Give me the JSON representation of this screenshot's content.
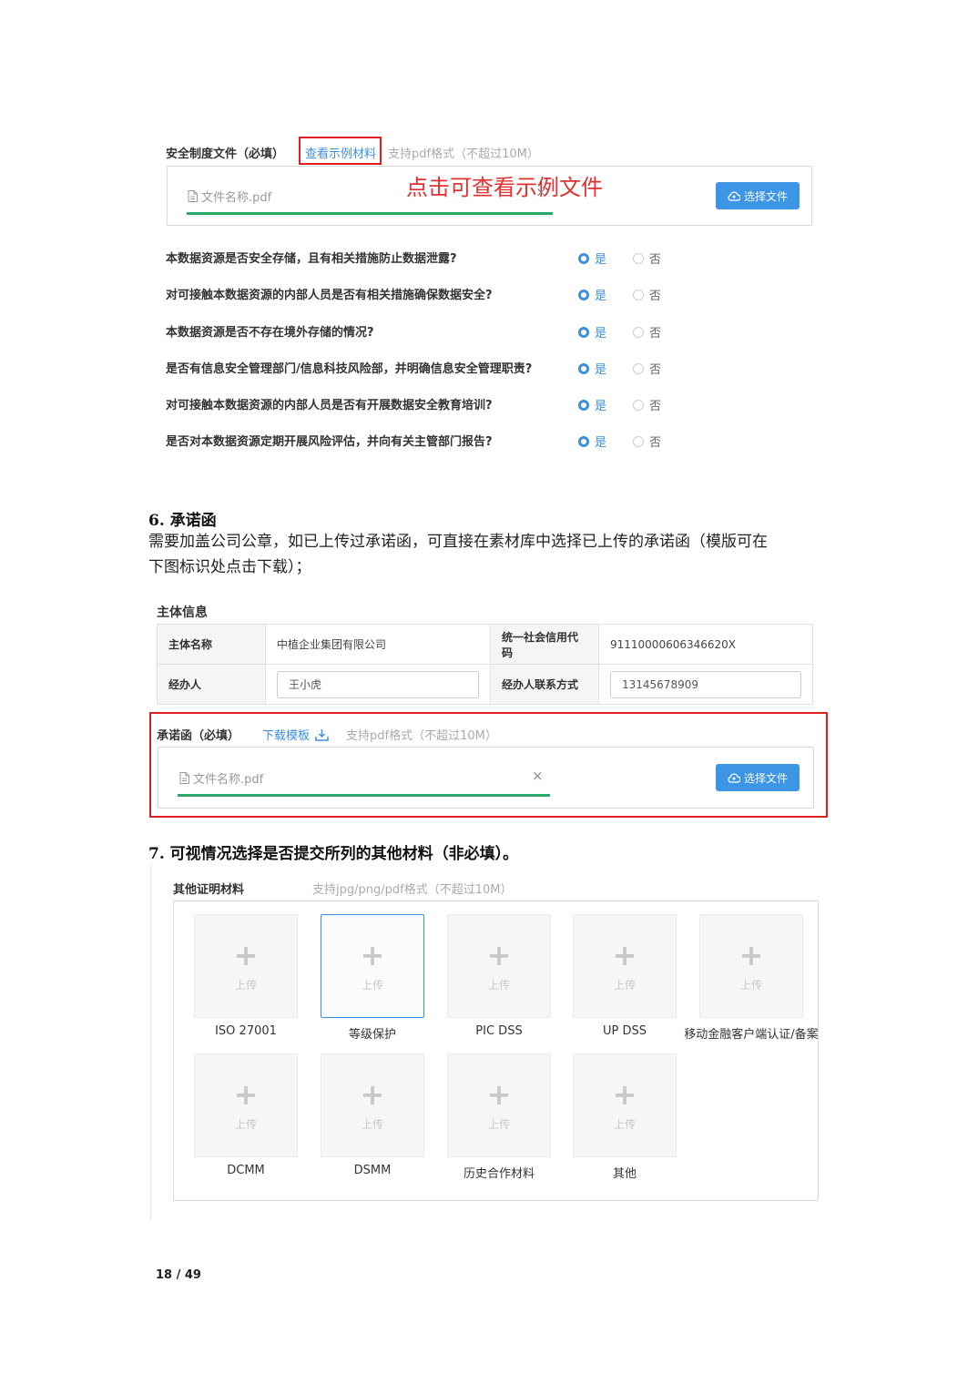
{
  "security_doc": {
    "label": "安全制度文件（必填）",
    "view_sample_link": "查看示例材料",
    "format_hint": "支持pdf格式（不超过10M）",
    "file_name": "文件名称.pdf",
    "close_symbol": "×",
    "choose_file_label": "选择文件",
    "annotation": "点击可查看示例文件"
  },
  "questions": [
    {
      "text": "本数据资源是否安全存储，且有相关措施防止数据泄露?",
      "yes": "是",
      "no": "否"
    },
    {
      "text": "对可接触本数据资源的内部人员是否有相关措施确保数据安全?",
      "yes": "是",
      "no": "否"
    },
    {
      "text": "本数据资源是否不存在境外存储的情况?",
      "yes": "是",
      "no": "否"
    },
    {
      "text": "是否有信息安全管理部门/信息科技风险部，并明确信息安全管理职责?",
      "yes": "是",
      "no": "否"
    },
    {
      "text": "对可接触本数据资源的内部人员是否有开展数据安全教育培训?",
      "yes": "是",
      "no": "否"
    },
    {
      "text": "是否对本数据资源定期开展风险评估，并向有关主管部门报告?",
      "yes": "是",
      "no": "否"
    }
  ],
  "section6": {
    "heading": "6.  承诺函",
    "para_line1": "需要加盖公司公章，如已上传过承诺函，可直接在素材库中选择已上传的承诺函（模版可在",
    "para_line2": "下图标识处点击下载）；"
  },
  "subject_info": {
    "title": "主体信息",
    "name_label": "主体名称",
    "name_value": "中植企业集团有限公司",
    "credit_label": "统一社会信用代码",
    "credit_value": "91110000606346620X",
    "agent_label": "经办人",
    "agent_value": "王小虎",
    "contact_label": "经办人联系方式",
    "contact_value": "13145678909"
  },
  "commitment": {
    "label": "承诺函（必填）",
    "download_link": "下载模板",
    "format_hint": "支持pdf格式（不超过10M）",
    "file_name": "文件名称.pdf",
    "close_symbol": "×",
    "choose_file_label": "选择文件"
  },
  "section7": {
    "heading": "7.  可视情况选择是否提交所列的其他材料（非必填）。"
  },
  "other_materials": {
    "label": "其他证明材料",
    "format_hint": "支持jpg/png/pdf格式（不超过10M）",
    "upload_label": "上传",
    "items": [
      "ISO 27001",
      "等级保护",
      "PIC DSS",
      "UP DSS",
      "移动金融客户端认证/备案",
      "DCMM",
      "DSMM",
      "历史合作材料",
      "其他"
    ]
  },
  "page_number": "18 / 49"
}
